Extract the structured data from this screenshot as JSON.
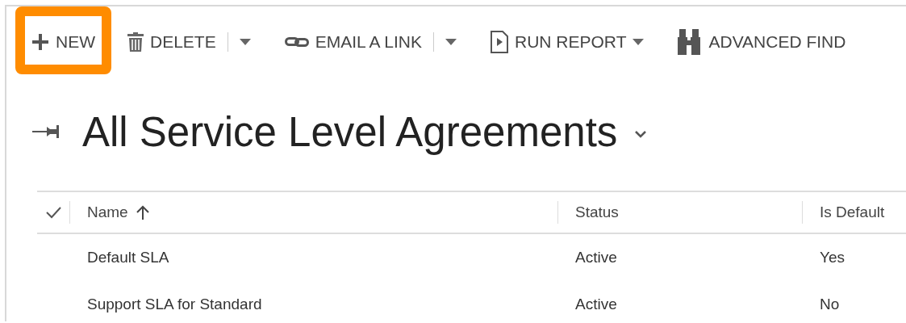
{
  "toolbar": [
    {
      "label": "NEW",
      "highlighted": true,
      "split": false,
      "dropdown": false
    },
    {
      "label": "DELETE",
      "highlighted": false,
      "split": true,
      "dropdown": false
    },
    {
      "label": "EMAIL A LINK",
      "highlighted": false,
      "split": true,
      "dropdown": false
    },
    {
      "label": "RUN REPORT",
      "highlighted": false,
      "split": false,
      "dropdown": true
    },
    {
      "label": "ADVANCED FIND",
      "highlighted": false,
      "split": false,
      "dropdown": false
    }
  ],
  "view": {
    "title": "All Service Level Agreements"
  },
  "table": {
    "columns": [
      {
        "label": "Name",
        "sorted_ascending": true
      },
      {
        "label": "Status",
        "sorted_ascending": false
      },
      {
        "label": "Is Default",
        "sorted_ascending": false
      }
    ],
    "rows": [
      [
        "Default SLA",
        "Active",
        "Yes"
      ],
      [
        "Support SLA for Standard",
        "Active",
        "No"
      ]
    ]
  }
}
